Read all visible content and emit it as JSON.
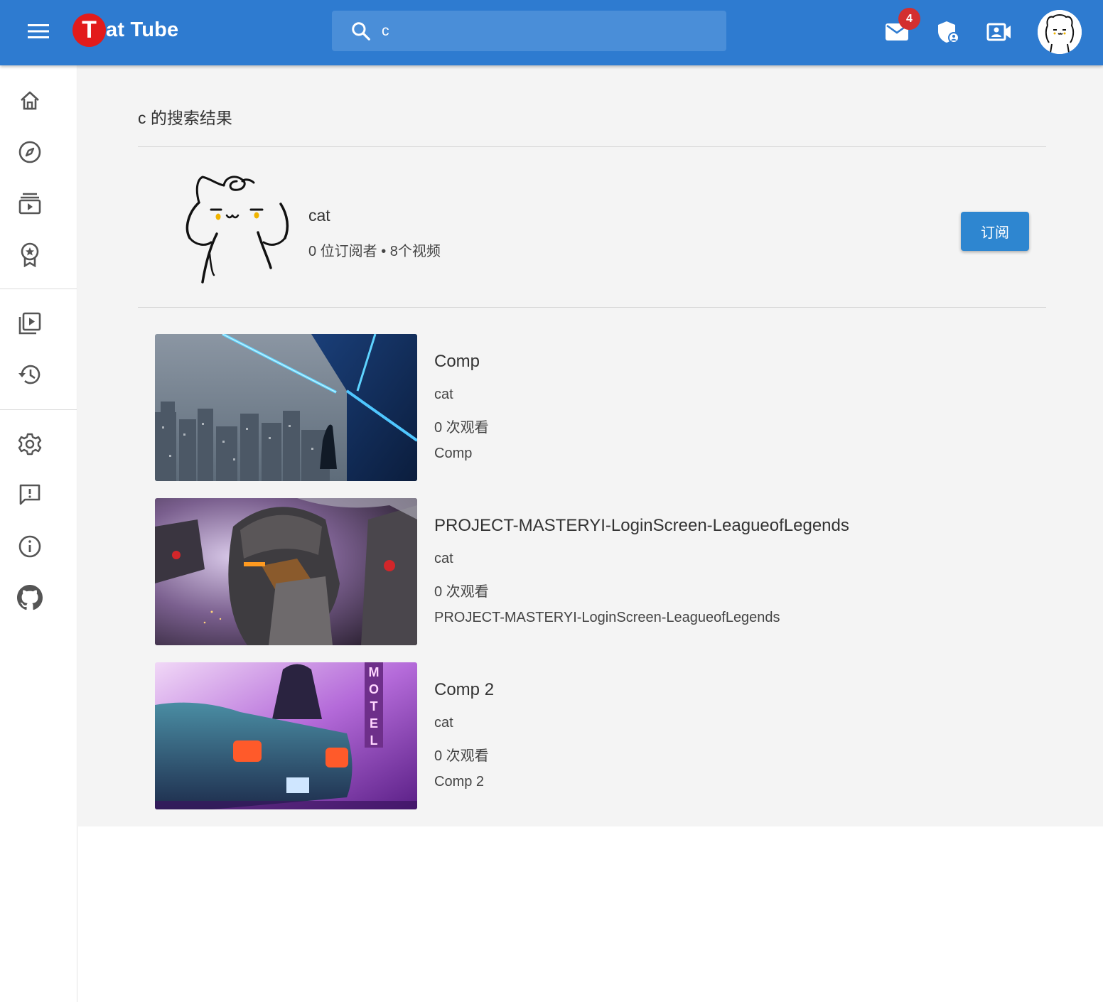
{
  "header": {
    "logo_letter": "T",
    "logo_text": "at Tube",
    "search_value": "c",
    "notification_count": "4",
    "icons": [
      "menu-icon",
      "search-icon",
      "mail-icon",
      "shield-icon",
      "video-camera-icon",
      "user-avatar"
    ]
  },
  "sidebar": {
    "items": [
      {
        "icon": "home-icon"
      },
      {
        "icon": "explore-icon"
      },
      {
        "icon": "subscriptions-icon"
      },
      {
        "icon": "award-icon"
      },
      {
        "icon": "video-library-icon"
      },
      {
        "icon": "history-icon"
      },
      {
        "icon": "settings-icon"
      },
      {
        "icon": "feedback-icon"
      },
      {
        "icon": "info-icon"
      },
      {
        "icon": "github-icon"
      }
    ]
  },
  "main": {
    "title": "c 的搜索结果",
    "channel": {
      "name": "cat",
      "meta": "0 位订阅者 • 8个视频",
      "subscribe_label": "订阅"
    },
    "videos": [
      {
        "title": "Comp",
        "channel": "cat",
        "views": "0 次观看",
        "description": "Comp"
      },
      {
        "title": "PROJECT-MASTERYI-LoginScreen-LeagueofLegends",
        "channel": "cat",
        "views": "0 次观看",
        "description": "PROJECT-MASTERYI-LoginScreen-LeagueofLegends"
      },
      {
        "title": "Comp 2",
        "channel": "cat",
        "views": "0 次观看",
        "description": "Comp 2"
      }
    ]
  },
  "colors": {
    "appbar": "#2e7bd0",
    "logo_badge": "#e21b1b",
    "subscribe_button": "#2e86d0",
    "notification_badge": "#d32f2f",
    "main_background": "#f4f4f4"
  }
}
